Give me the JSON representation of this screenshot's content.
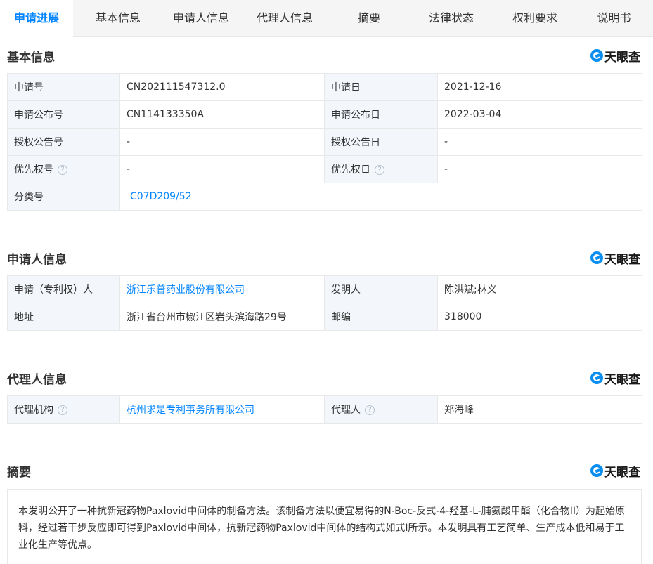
{
  "tabs": [
    {
      "label": "申请进展",
      "active": true
    },
    {
      "label": "基本信息",
      "active": false
    },
    {
      "label": "申请人信息",
      "active": false
    },
    {
      "label": "代理人信息",
      "active": false
    },
    {
      "label": "摘要",
      "active": false
    },
    {
      "label": "法律状态",
      "active": false
    },
    {
      "label": "权利要求",
      "active": false
    },
    {
      "label": "说明书",
      "active": false
    }
  ],
  "brand": {
    "name": "天眼查",
    "icon": "tianyancha-logo-icon",
    "color": "#0a8ef0"
  },
  "help_glyph": "?",
  "basic": {
    "title": "基本信息",
    "app_no_label": "申请号",
    "app_no": "CN202111547312.0",
    "app_date_label": "申请日",
    "app_date": "2021-12-16",
    "pub_no_label": "申请公布号",
    "pub_no": "CN114133350A",
    "pub_date_label": "申请公布日",
    "pub_date": "2022-03-04",
    "grant_no_label": "授权公告号",
    "grant_no": "-",
    "grant_date_label": "授权公告日",
    "grant_date": "-",
    "priority_no_label": "优先权号",
    "priority_no": "-",
    "priority_date_label": "优先权日",
    "priority_date": "-",
    "class_label": "分类号",
    "class_value": "C07D209/52"
  },
  "applicant": {
    "title": "申请人信息",
    "holder_label": "申请（专利权）人",
    "holder": "浙江乐普药业股份有限公司",
    "inventor_label": "发明人",
    "inventor": "陈洪斌;林义",
    "address_label": "地址",
    "address": "浙江省台州市椒江区岩头滨海路29号",
    "postcode_label": "邮编",
    "postcode": "318000"
  },
  "agent": {
    "title": "代理人信息",
    "agency_label": "代理机构",
    "agency": "杭州求是专利事务所有限公司",
    "agent_label": "代理人",
    "agent": "郑海峰"
  },
  "abstract": {
    "title": "摘要",
    "text": "本发明公开了一种抗新冠药物Paxlovid中间体的制备方法。该制备方法以便宜易得的N-Boc-反式-4-羟基-L-脯氨酸甲酯（化合物II）为起始原料，经过若干步反应即可得到Paxlovid中间体，抗新冠药物Paxlovid中间体的结构式如式I所示。本发明具有工艺简单、生产成本低和易于工业化生产等优点。"
  },
  "colors": {
    "accent": "#0084ff",
    "label_bg": "#f3f7fc",
    "border": "#e8e8e8",
    "tab_bar": "#f5f5f5"
  }
}
